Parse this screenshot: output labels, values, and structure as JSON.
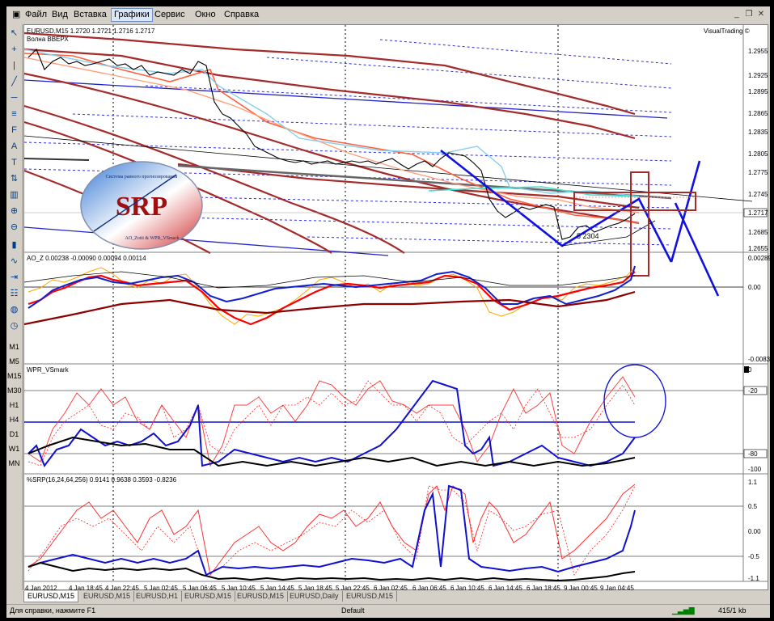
{
  "menu": [
    "Файл",
    "Вид",
    "Вставка",
    "Графики",
    "Сервис",
    "Окно",
    "Справка"
  ],
  "active_menu_index": 3,
  "timeframes": [
    "M1",
    "M5",
    "M15",
    "M30",
    "H1",
    "H4",
    "D1",
    "W1",
    "MN"
  ],
  "chart": {
    "header": "EURUSD,M15  1.2720 1.2721 1.2716 1.2717",
    "subtitle": "Волна ВВЕРХ",
    "brand": "VisualTrading ©",
    "price_axis": [
      "1.2955",
      "1.2925",
      "1.2895",
      "1.2865",
      "1.2835",
      "1.2805",
      "1.2775",
      "1.2745",
      "1.2717",
      "1.2685",
      "1.2655"
    ],
    "current_price": "1.2717",
    "annotation": "5 2304",
    "logo_text": "SRP",
    "logo_caption_top": "Система равного прогнозирования",
    "logo_caption_bottom": "AO_Zotti & WPR_VSmark"
  },
  "panes": {
    "ao": {
      "label": "AO_Z 0.00238 -0.00090 0.00094 0.00114",
      "axis": [
        "0.00289",
        "0.00",
        "-0.00836"
      ]
    },
    "wpr": {
      "label": "WPR_VSmark",
      "axis": [
        "0",
        "-20",
        "-80",
        "-100"
      ]
    },
    "srp": {
      "label": "%SRP(16,24,64,256) 0.9141 0.9638 0.3593 -0.8236",
      "axis": [
        "1.1",
        "0.5",
        "0.00",
        "-0.5",
        "-1.1"
      ]
    }
  },
  "time_axis": [
    "4 Jan 2012",
    "4 Jan 18:45",
    "4 Jan 22:45",
    "5 Jan 02:45",
    "5 Jan 06:45",
    "5 Jan 10:45",
    "5 Jan 14:45",
    "5 Jan 18:45",
    "5 Jan 22:45",
    "6 Jan 02:45",
    "6 Jan 06:45",
    "6 Jan 10:45",
    "6 Jan 14:45",
    "6 Jan 18:45",
    "9 Jan 00:45",
    "9 Jan 04:45"
  ],
  "tabs": [
    "EURUSD,M15",
    "EURUSD,M15",
    "EURUSD,H1",
    "EURUSD,M15",
    "EURUSD,M15",
    "EURUSD,Daily",
    "EURUSD,M15"
  ],
  "status": {
    "help": "Для справки, нажмите F1",
    "profile": "Default",
    "traffic": "415/1 kb"
  },
  "colors": {
    "price": "#000000",
    "channel": "#a52a2a",
    "trend": "#2222cc",
    "signal": "#ff0000",
    "ma_slow": "#87ceeb",
    "ao_osc": "#ffa500",
    "ao_slow": "#8b0000"
  }
}
